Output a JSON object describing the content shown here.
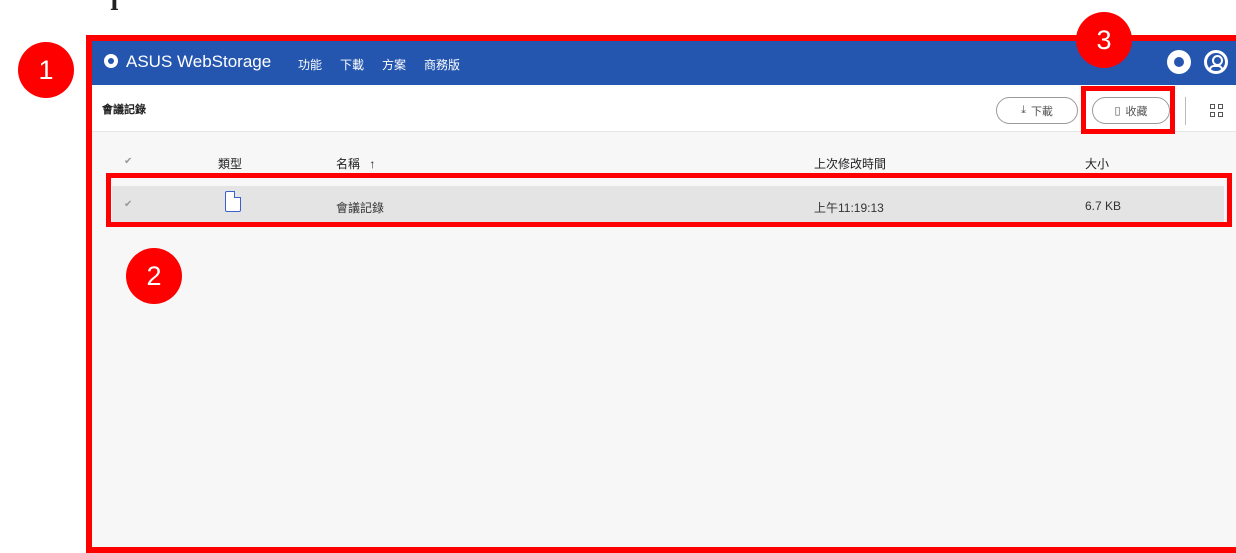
{
  "app": {
    "brand": "ASUS WebStorage",
    "nav": [
      "功能",
      "下載",
      "方案",
      "商務版"
    ]
  },
  "toolbar": {
    "title": "會議記錄",
    "download_label": "下載",
    "favorite_label": "收藏"
  },
  "table": {
    "columns": {
      "type": "類型",
      "name": "名稱",
      "modified": "上次修改時間",
      "size": "大小"
    },
    "sort_indicator": "↑",
    "rows": [
      {
        "name": "會議記錄",
        "modified": "上午11:19:13",
        "size": "6.7 KB"
      }
    ]
  },
  "annotations": [
    "1",
    "2",
    "3"
  ],
  "colors": {
    "header": "#2456b0",
    "highlight": "#ff0000",
    "row_selected": "#e4e4e4"
  }
}
